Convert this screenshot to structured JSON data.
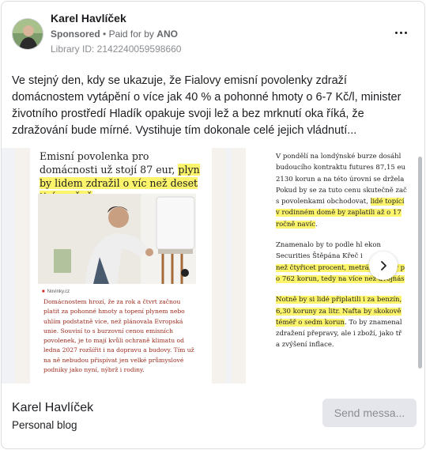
{
  "ad": {
    "page_name": "Karel Havlíček",
    "sponsored": "Sponsored",
    "separator": "•",
    "paid_for_prefix": "Paid for by",
    "paid_for_by": "ANO",
    "library_id": "Library ID: 2142240059598660",
    "body": "Ve stejný den, kdy se ukazuje, že Fialovy emisní povolenky zdraží domácnostem vytápění o více jak 40 % a pohonné hmoty o 6-7 Kč/l, minister životního prostředí Hladík opakuje svoji lež a bez mrknutí oka říká, že zdražování bude mírné. Vystihuje tím dokonale celé jejich vládnutí..."
  },
  "slide1": {
    "headline_plain": "Emisní povolenka pro domácnosti už stojí 87 eur, ",
    "headline_highlight": "plyn by lidem zdražil o víc než deset tisíc ročně",
    "source": "Novinky.cz",
    "article": "Domácnostem hrozí, že za rok a čtvrt začnou platit za pohonné hmoty a topení plynem nebo uhlím podstatně více, než plánovala Evropská unie. Souvisí to s burzovní cenou emisních povolenek, je to mají kvůli ochraně klimatu od ledna 2027 rozšířit i na dopravu a budovy. Tím už na ně nebudou přispívat jen velké průmyslové podniky jako nyní, nýbrž i rodiny."
  },
  "slide2": {
    "p1_lines": [
      "V pondělí na londýnské burze dosáhl",
      "budoucího kontraktu futures 87,15 eu",
      "2130 korun a na této úrovni se držela",
      "Pokud by se za tuto cenu skutečně zač",
      "s povolenkami obchodovat, "
    ],
    "p1_highlight_1": "lidé topící",
    "p1_highlight_2": "v rodinném domě by zaplatili až o 17",
    "p1_highlight_3": "ročně navíc",
    "p1_end": ".",
    "p2_line1": "Znamenalo by to podle hl          ekon",
    "p2_line2": "Securities Štěpána Křeč          i",
    "p2_highlight_1": "než čtyřicet procent, metrák uhlí by p",
    "p2_highlight_2": "o 762 korun, tedy na více než dvojnás",
    "p3_highlight_1": "Notně by si lidé připlatili i za benzín,",
    "p3_highlight_2": "6,30 koruny za litr. Nafta by skokově",
    "p3_highlight_3": "téměř o sedm korun",
    "p3_rest_1": ". To by znamenal",
    "p3_line_4": "zdražení přepravy, ale i zboží, jako tř",
    "p3_line_5": "a zvýšení inflace."
  },
  "footer": {
    "name": "Karel Havlíček",
    "category": "Personal blog",
    "send_button": "Send messa..."
  }
}
